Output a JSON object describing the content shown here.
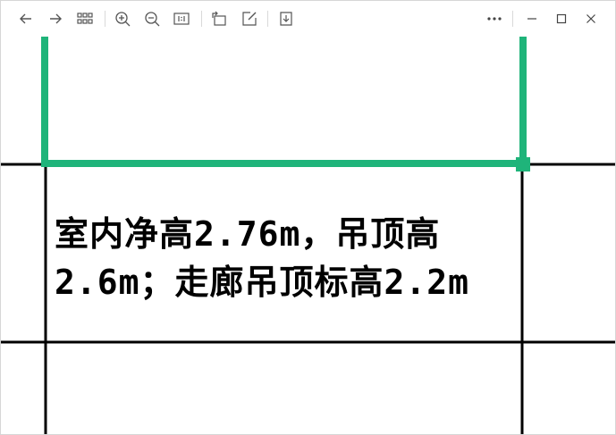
{
  "toolbar": {
    "left_icons": [
      "back-arrow-icon",
      "forward-arrow-icon",
      "grid-icon",
      "zoom-in-icon",
      "zoom-out-icon",
      "actual-size-icon",
      "rotate-icon",
      "edit-icon",
      "download-icon"
    ],
    "right_icons": [
      "more-icon",
      "minimize-icon",
      "maximize-icon",
      "close-icon"
    ]
  },
  "drawing": {
    "line1": "室内净高2.76m，吊顶高",
    "line2": "2.6m；走廊吊顶标高2.2m",
    "highlight_color": "#1fb47a",
    "line_color": "#000000"
  }
}
